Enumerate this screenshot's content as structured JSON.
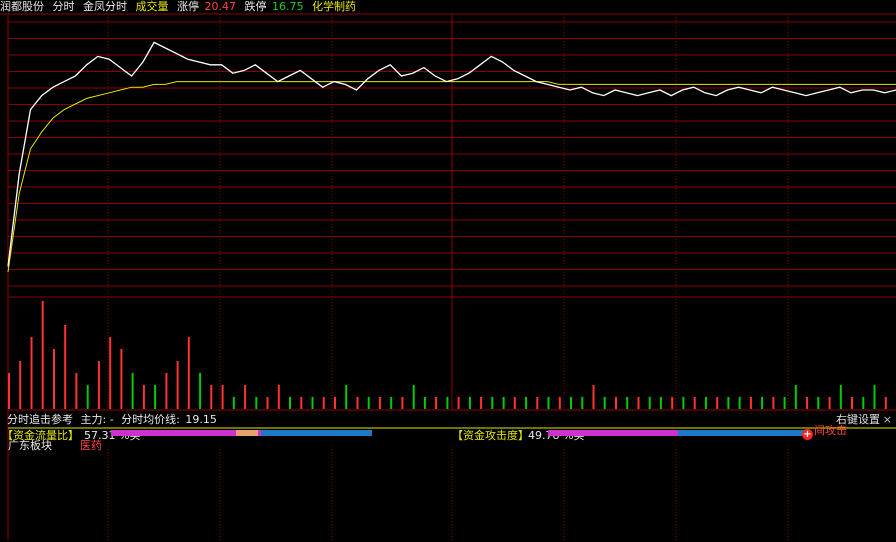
{
  "header": {
    "stock_name": "润都股份",
    "view_label": "分时",
    "indicator_label": "金凤分时",
    "volume_label": "成交量",
    "limit_up_label": "涨停",
    "limit_up_value": "20.47",
    "limit_down_label": "跌停",
    "limit_down_value": "16.75",
    "sector": "化学制药",
    "close_icon": "close-icon"
  },
  "indicator_bar": {
    "name": "分时追击参考",
    "main_force": "主力: -",
    "avg_line_label": "分时均价线:",
    "avg_line_value": "19.15",
    "right_key": "右键设置",
    "close_glyph": "×"
  },
  "capital_panel": {
    "flow_ratio_label": "【资金流量比】",
    "flow_ratio_value": "57.31 %买",
    "attack_label": "【资金攻击度】",
    "attack_value": "49.78 %买",
    "region_label": "广东板块",
    "tag_label": "医药",
    "attack_marker_label": "间攻击",
    "flow_ratio_fraction": 0.5731,
    "attack_fraction": 0.4978
  },
  "colors": {
    "price_line": "#ffffff",
    "avg_line": "#e6e600",
    "grid": "#8b0000",
    "up": "#ff3333",
    "down": "#00cc00",
    "buy_bar": "#cc33cc",
    "sell_bar": "#1e78c8"
  },
  "chart_data": {
    "type": "line",
    "series": [
      {
        "name": "price",
        "values": [
          18.72,
          19.05,
          19.28,
          19.33,
          19.36,
          19.38,
          19.4,
          19.44,
          19.47,
          19.46,
          19.43,
          19.4,
          19.45,
          19.52,
          19.5,
          19.48,
          19.46,
          19.45,
          19.44,
          19.44,
          19.41,
          19.42,
          19.44,
          19.41,
          19.38,
          19.4,
          19.42,
          19.39,
          19.36,
          19.38,
          19.37,
          19.35,
          19.39,
          19.42,
          19.44,
          19.4,
          19.41,
          19.43,
          19.4,
          19.38,
          19.39,
          19.41,
          19.44,
          19.47,
          19.45,
          19.42,
          19.4,
          19.38,
          19.37,
          19.36,
          19.35,
          19.36,
          19.34,
          19.33,
          19.35,
          19.34,
          19.33,
          19.34,
          19.35,
          19.33,
          19.35,
          19.36,
          19.34,
          19.33,
          19.35,
          19.36,
          19.35,
          19.34,
          19.36,
          19.35,
          19.34,
          19.33,
          19.34,
          19.35,
          19.36,
          19.34,
          19.35,
          19.35,
          19.34,
          19.35
        ]
      },
      {
        "name": "avg",
        "values": [
          18.7,
          18.98,
          19.14,
          19.2,
          19.25,
          19.28,
          19.3,
          19.32,
          19.33,
          19.34,
          19.35,
          19.36,
          19.36,
          19.37,
          19.37,
          19.38,
          19.38,
          19.38,
          19.38,
          19.38,
          19.38,
          19.38,
          19.38,
          19.38,
          19.38,
          19.38,
          19.38,
          19.38,
          19.38,
          19.38,
          19.38,
          19.38,
          19.38,
          19.38,
          19.38,
          19.38,
          19.38,
          19.38,
          19.38,
          19.38,
          19.38,
          19.38,
          19.38,
          19.38,
          19.38,
          19.38,
          19.38,
          19.38,
          19.38,
          19.37,
          19.37,
          19.37,
          19.37,
          19.37,
          19.37,
          19.37,
          19.37,
          19.37,
          19.37,
          19.37,
          19.37,
          19.37,
          19.37,
          19.37,
          19.37,
          19.37,
          19.37,
          19.37,
          19.37,
          19.37,
          19.37,
          19.37,
          19.37,
          19.37,
          19.37,
          19.37,
          19.37,
          19.37,
          19.37,
          19.37
        ]
      }
    ],
    "volume": [
      3,
      4,
      6,
      9,
      5,
      7,
      3,
      2,
      4,
      6,
      5,
      3,
      2,
      2,
      3,
      4,
      6,
      3,
      2,
      2,
      1,
      2,
      1,
      1,
      2,
      1,
      1,
      1,
      1,
      1,
      2,
      1,
      1,
      1,
      1,
      1,
      2,
      1,
      1,
      1,
      1,
      1,
      1,
      1,
      1,
      1,
      1,
      1,
      1,
      1,
      1,
      1,
      2,
      1,
      1,
      1,
      1,
      1,
      1,
      1,
      1,
      1,
      1,
      1,
      1,
      1,
      1,
      1,
      1,
      1,
      2,
      1,
      1,
      1,
      2,
      1,
      1,
      2,
      1,
      1
    ],
    "volume_colors": [
      "up",
      "up",
      "up",
      "up",
      "up",
      "up",
      "up",
      "down",
      "up",
      "up",
      "up",
      "down",
      "up",
      "down",
      "up",
      "up",
      "up",
      "down",
      "up",
      "up",
      "down",
      "up",
      "down",
      "up",
      "up",
      "down",
      "up",
      "down",
      "up",
      "up",
      "down",
      "up",
      "down",
      "up",
      "down",
      "up",
      "down",
      "down",
      "up",
      "down",
      "up",
      "down",
      "up",
      "down",
      "down",
      "up",
      "down",
      "up",
      "down",
      "up",
      "down",
      "down",
      "up",
      "down",
      "up",
      "down",
      "up",
      "down",
      "down",
      "up",
      "down",
      "up",
      "down",
      "up",
      "down",
      "down",
      "up",
      "down",
      "up",
      "down",
      "down",
      "up",
      "down",
      "up",
      "down",
      "up",
      "down",
      "down",
      "up",
      "down"
    ]
  }
}
